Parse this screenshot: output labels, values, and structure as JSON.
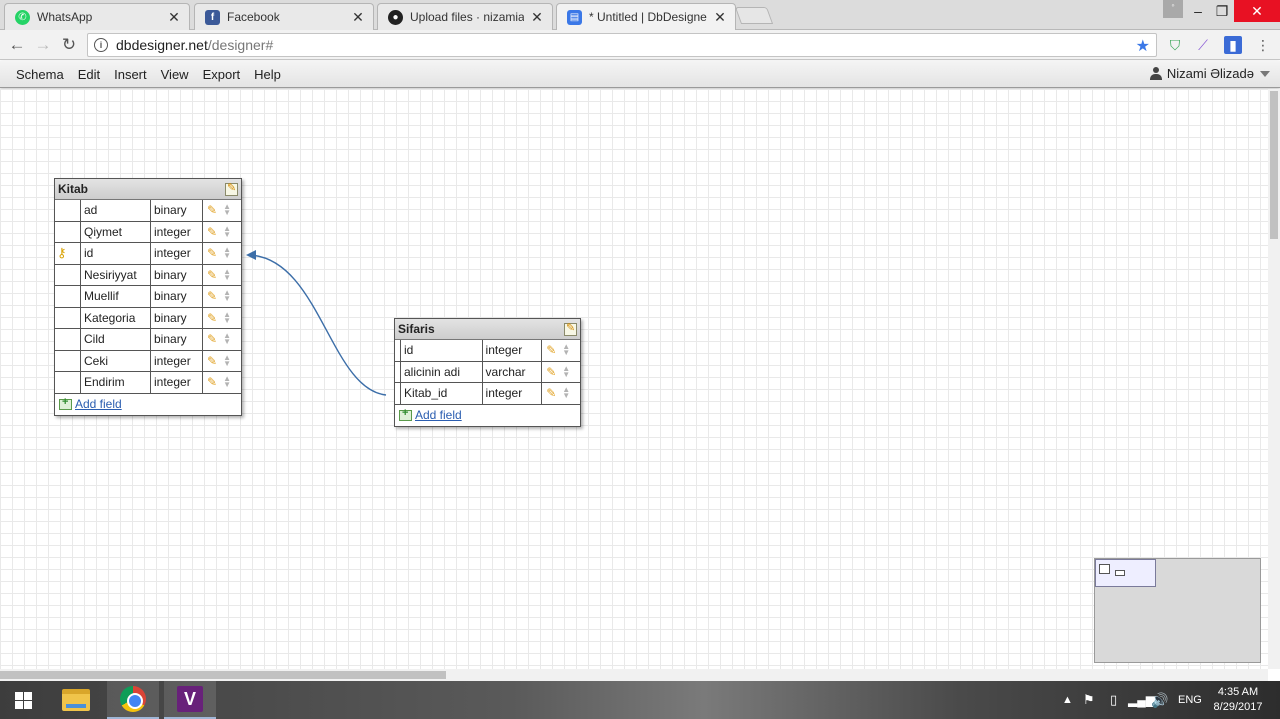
{
  "browser": {
    "tabs": [
      {
        "title": "WhatsApp",
        "icon": "whatsapp-icon",
        "color": "#25d366",
        "active": false
      },
      {
        "title": "Facebook",
        "icon": "facebook-icon",
        "color": "#3b5998",
        "active": false
      },
      {
        "title": "Upload files · nizamializa",
        "icon": "github-icon",
        "color": "#222222",
        "active": false
      },
      {
        "title": "* Untitled | DbDesigner.n",
        "icon": "dbdesigner-icon",
        "color": "#3b78e7",
        "active": true
      }
    ],
    "url_host": "dbdesigner.net",
    "url_path": "/designer#"
  },
  "menubar": {
    "items": [
      "Schema",
      "Edit",
      "Insert",
      "View",
      "Export",
      "Help"
    ],
    "user_name": "Nizami Əlizadə"
  },
  "tables": [
    {
      "name": "Kitab",
      "add_field_label": "Add field",
      "fields": [
        {
          "name": "ad",
          "type": "binary",
          "primary_key": false
        },
        {
          "name": "Qiymet",
          "type": "integer",
          "primary_key": false
        },
        {
          "name": "id",
          "type": "integer",
          "primary_key": true
        },
        {
          "name": "Nesiriyyat",
          "type": "binary",
          "primary_key": false
        },
        {
          "name": "Muellif",
          "type": "binary",
          "primary_key": false
        },
        {
          "name": "Kategoria",
          "type": "binary",
          "primary_key": false
        },
        {
          "name": "Cild",
          "type": "binary",
          "primary_key": false
        },
        {
          "name": "Ceki",
          "type": "integer",
          "primary_key": false
        },
        {
          "name": "Endirim",
          "type": "integer",
          "primary_key": false
        }
      ]
    },
    {
      "name": "Sifaris",
      "add_field_label": "Add field",
      "fields": [
        {
          "name": "id",
          "type": "integer",
          "primary_key": false
        },
        {
          "name": "alicinin adi",
          "type": "varchar",
          "primary_key": false
        },
        {
          "name": "Kitab_id",
          "type": "integer",
          "primary_key": false
        }
      ]
    }
  ],
  "relation": {
    "from": "Sifaris.Kitab_id",
    "to": "Kitab.id",
    "color": "#3c6ea8"
  },
  "taskbar": {
    "apps": [
      "file-explorer-icon",
      "chrome-icon",
      "visual-studio-icon"
    ],
    "language": "ENG",
    "time": "4:35 AM",
    "date": "8/29/2017"
  }
}
